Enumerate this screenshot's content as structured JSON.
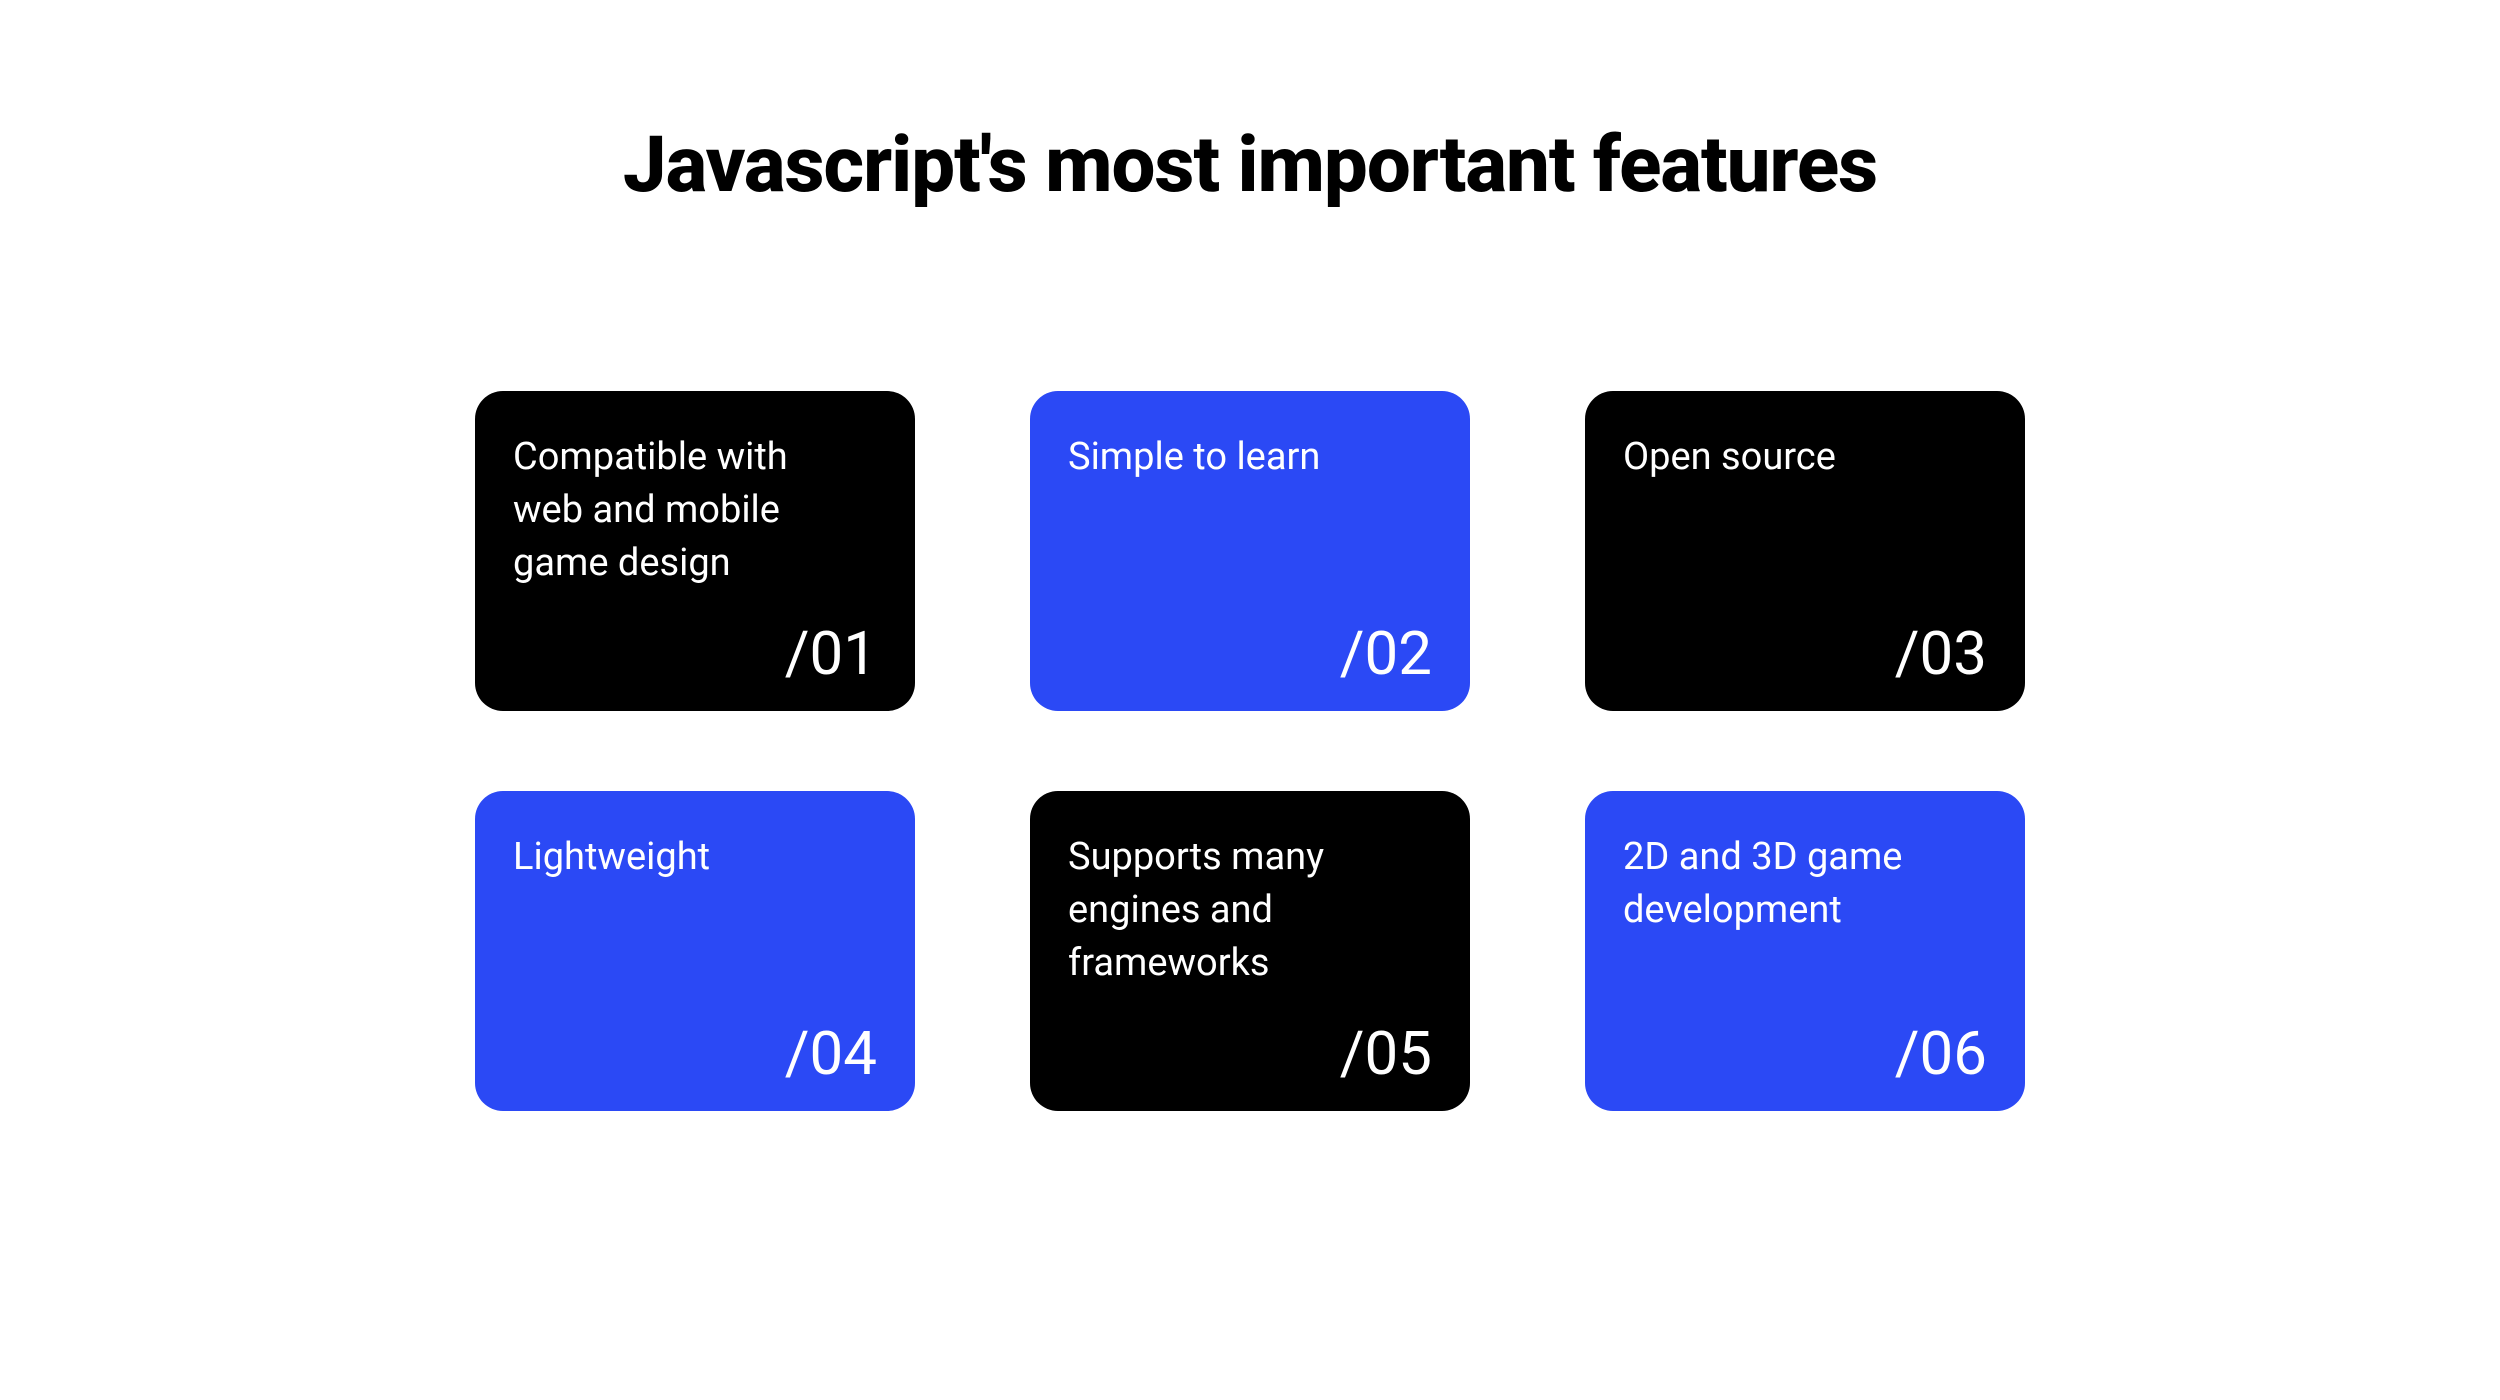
{
  "title": "Javascript's most important features",
  "cards": [
    {
      "text": "Compatible with web and mobile game design",
      "number": "/01",
      "color": "black"
    },
    {
      "text": "Simple to learn",
      "number": "/02",
      "color": "blue"
    },
    {
      "text": "Open source",
      "number": "/03",
      "color": "black"
    },
    {
      "text": "Lightweight",
      "number": "/04",
      "color": "blue"
    },
    {
      "text": "Supports many engines and frameworks",
      "number": "/05",
      "color": "black"
    },
    {
      "text": "2D and 3D game development",
      "number": "/06",
      "color": "blue"
    }
  ]
}
